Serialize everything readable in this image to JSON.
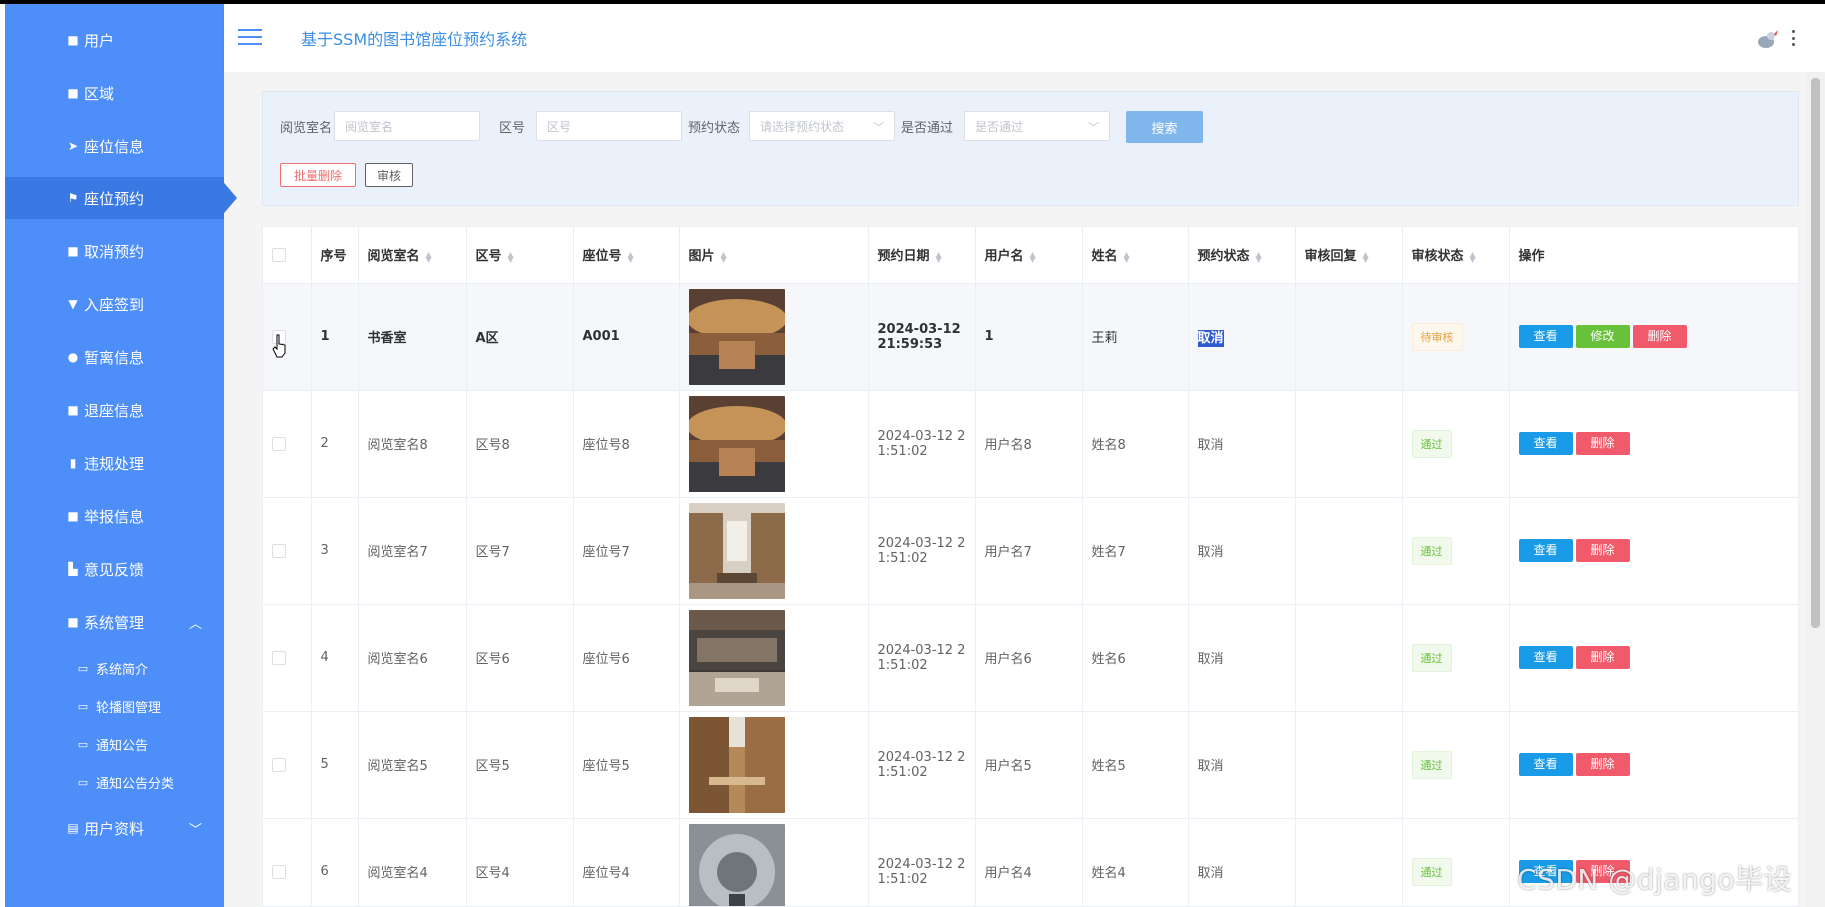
{
  "app_title": "基于SSM的图书馆座位预约系统",
  "sidebar": {
    "items": [
      {
        "label": "用户",
        "icon": "grid-icon"
      },
      {
        "label": "区域",
        "icon": "grid-icon"
      },
      {
        "label": "座位信息",
        "icon": "send-icon"
      },
      {
        "label": "座位预约",
        "icon": "flag-icon"
      },
      {
        "label": "取消预约",
        "icon": "grid-icon"
      },
      {
        "label": "入座签到",
        "icon": "paint-icon"
      },
      {
        "label": "暂离信息",
        "icon": "user-icon"
      },
      {
        "label": "退座信息",
        "icon": "grid-icon"
      },
      {
        "label": "违规处理",
        "icon": "clipboard-icon"
      },
      {
        "label": "举报信息",
        "icon": "grid-icon"
      },
      {
        "label": "意见反馈",
        "icon": "chart-icon"
      },
      {
        "label": "系统管理",
        "icon": "grid-icon"
      }
    ],
    "sub_items": [
      {
        "label": "系统简介"
      },
      {
        "label": "轮播图管理"
      },
      {
        "label": "通知公告"
      },
      {
        "label": "通知公告分类"
      }
    ],
    "last_item": {
      "label": "用户资料"
    }
  },
  "search": {
    "room_label": "阅览室名",
    "room_placeholder": "阅览室名",
    "area_label": "区号",
    "area_placeholder": "区号",
    "status_label": "预约状态",
    "status_placeholder": "请选择预约状态",
    "pass_label": "是否通过",
    "pass_placeholder": "是否通过",
    "search_button": "搜索",
    "batch_delete": "批量删除",
    "audit": "审核"
  },
  "table": {
    "headers": {
      "index": "序号",
      "room": "阅览室名",
      "area": "区号",
      "seat": "座位号",
      "image": "图片",
      "date": "预约日期",
      "username": "用户名",
      "name": "姓名",
      "status": "预约状态",
      "reply": "审核回复",
      "audit": "审核状态",
      "ops": "操作"
    },
    "rows": [
      {
        "index": "1",
        "room": "书香室",
        "area": "A区",
        "seat": "A001",
        "date1": "2024-03-12",
        "date2": "21:59:53",
        "username": "1",
        "name": "王莉",
        "status": "取消",
        "reply": "",
        "audit": "待审核"
      },
      {
        "index": "2",
        "room": "阅览室名8",
        "area": "区号8",
        "seat": "座位号8",
        "date1": "2024-03-12 2",
        "date2": "1:51:02",
        "username": "用户名8",
        "name": "姓名8",
        "status": "取消",
        "reply": "",
        "audit": "通过"
      },
      {
        "index": "3",
        "room": "阅览室名7",
        "area": "区号7",
        "seat": "座位号7",
        "date1": "2024-03-12 2",
        "date2": "1:51:02",
        "username": "用户名7",
        "name": "姓名7",
        "status": "取消",
        "reply": "",
        "audit": "通过"
      },
      {
        "index": "4",
        "room": "阅览室名6",
        "area": "区号6",
        "seat": "座位号6",
        "date1": "2024-03-12 2",
        "date2": "1:51:02",
        "username": "用户名6",
        "name": "姓名6",
        "status": "取消",
        "reply": "",
        "audit": "通过"
      },
      {
        "index": "5",
        "room": "阅览室名5",
        "area": "区号5",
        "seat": "座位号5",
        "date1": "2024-03-12 2",
        "date2": "1:51:02",
        "username": "用户名5",
        "name": "姓名5",
        "status": "取消",
        "reply": "",
        "audit": "通过"
      },
      {
        "index": "6",
        "room": "阅览室名4",
        "area": "区号4",
        "seat": "座位号4",
        "date1": "2024-03-12 2",
        "date2": "1:51:02",
        "username": "用户名4",
        "name": "姓名4",
        "status": "取消",
        "reply": "",
        "audit": "通过"
      }
    ],
    "ops": {
      "view": "查看",
      "edit": "修改",
      "delete": "删除"
    }
  },
  "watermark": "CSDN @django毕设",
  "colors": {
    "sidebar": "#4d8ef8",
    "sidebar_active": "#3a79e4",
    "primary": "#1a9be8",
    "success": "#67c23a",
    "danger": "#f05a6b",
    "warning": "#e6a23c"
  }
}
